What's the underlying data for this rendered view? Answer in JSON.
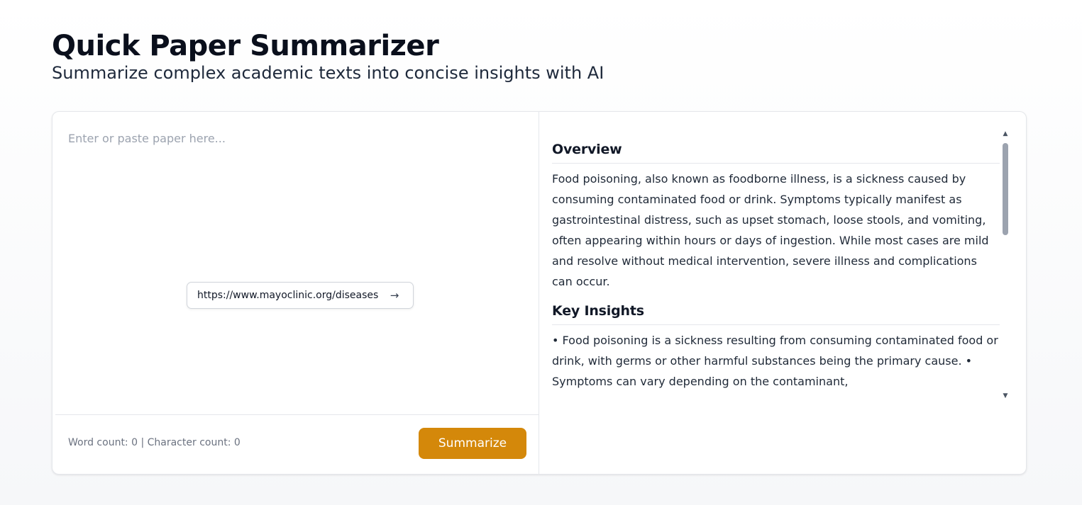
{
  "header": {
    "title": "Quick Paper Summarizer",
    "subtitle": "Summarize complex academic texts into concise insights with AI"
  },
  "editor": {
    "placeholder": "Enter or paste paper here...",
    "url_value": "https://www.mayoclinic.org/diseases",
    "url_submit_icon": "arrow-right-icon"
  },
  "footer": {
    "counts": "Word count: 0 | Character count: 0",
    "summarize_label": "Summarize"
  },
  "summary": {
    "sections": [
      {
        "title": "Overview",
        "body": "Food poisoning, also known as foodborne illness, is a sickness caused by consuming contaminated food or drink. Symptoms typically manifest as gastrointestinal distress, such as upset stomach, loose stools, and vomiting, often appearing within hours or days of ingestion. While most cases are mild and resolve without medical intervention, severe illness and complications can occur."
      },
      {
        "title": "Key Insights",
        "body": "• Food poisoning is a sickness resulting from consuming contaminated food or drink, with germs or other harmful substances being the primary cause. • Symptoms can vary depending on the contaminant,"
      }
    ]
  },
  "colors": {
    "accent": "#d4880a",
    "text": "#1f2937",
    "muted": "#6b7280",
    "border": "#e5e7eb"
  }
}
